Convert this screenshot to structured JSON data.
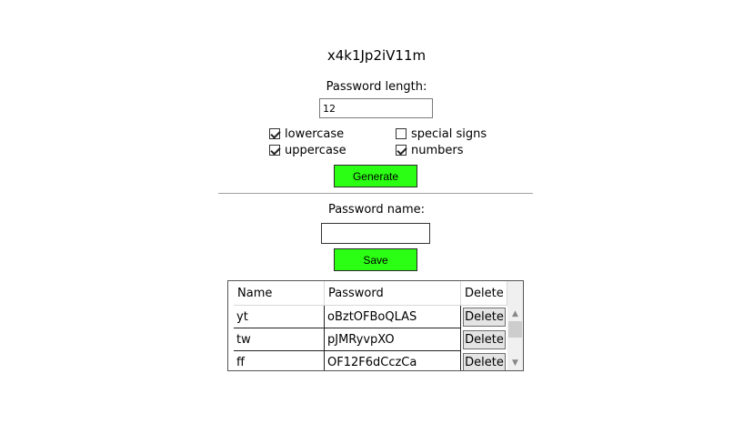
{
  "generated_password": "x4k1Jp2iV11m",
  "length": {
    "label": "Password length:",
    "value": "12"
  },
  "options": [
    {
      "label": "lowercase",
      "checked": true
    },
    {
      "label": "special signs",
      "checked": false
    },
    {
      "label": "uppercase",
      "checked": true
    },
    {
      "label": "numbers",
      "checked": true
    }
  ],
  "generate_label": "Generate",
  "name": {
    "label": "Password name:",
    "value": ""
  },
  "save_label": "Save",
  "table": {
    "columns": [
      "Name",
      "Password",
      "Delete"
    ],
    "rows": [
      {
        "name": "yt",
        "password": "oBztOFBoQLAS",
        "action": "Delete"
      },
      {
        "name": "tw",
        "password": "pJMRyvpXO",
        "action": "Delete"
      },
      {
        "name": "ff",
        "password": "OF12F6dCczCa",
        "action": "Delete"
      }
    ]
  },
  "colors": {
    "button_green": "#2bff13"
  }
}
